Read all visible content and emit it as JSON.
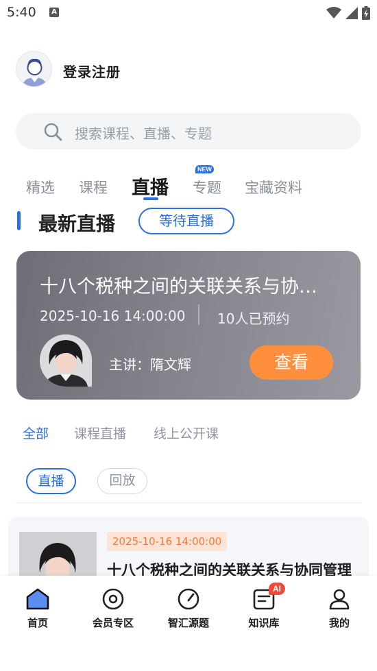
{
  "status_bar": {
    "time": "5:40",
    "notification_letter": "A"
  },
  "profile": {
    "login_label": "登录注册",
    "avatar_icon": "user-avatar-icon"
  },
  "search": {
    "placeholder": "搜索课程、直播、专题",
    "icon": "search-icon"
  },
  "main_tabs": [
    {
      "label": "精选",
      "active": false
    },
    {
      "label": "课程",
      "active": false
    },
    {
      "label": "直播",
      "active": true
    },
    {
      "label": "专题",
      "active": false,
      "badge": "NEW"
    },
    {
      "label": "宝藏资料",
      "active": false
    }
  ],
  "section": {
    "title": "最新直播",
    "waiting_button": "等待直播"
  },
  "live_card": {
    "title": "十八个税种之间的关联关系与协同管理",
    "date": "2025-10-16 14:00:00",
    "booked": "10人已预约",
    "lecturer": "主讲：隋文辉",
    "view_button": "查看"
  },
  "category_tabs": [
    {
      "label": "全部",
      "active": true
    },
    {
      "label": "课程直播",
      "active": false
    },
    {
      "label": "线上公开课",
      "active": false
    }
  ],
  "filters": [
    {
      "label": "直播",
      "active": true
    },
    {
      "label": "回放",
      "active": false
    }
  ],
  "list_items": [
    {
      "date": "2025-10-16 14:00:00",
      "title": "十八个税种之间的关联关系与协同管理"
    }
  ],
  "bottom_nav": [
    {
      "label": "首页",
      "icon": "home-icon",
      "active": true
    },
    {
      "label": "会员专区",
      "icon": "vip-circle-icon",
      "active": false
    },
    {
      "label": "智汇源题",
      "icon": "gauge-icon",
      "active": false
    },
    {
      "label": "知识库",
      "icon": "note-icon",
      "active": false,
      "badge": "AI"
    },
    {
      "label": "我的",
      "icon": "person-icon",
      "active": false
    }
  ],
  "colors": {
    "accent": "#2a6fe0",
    "orange": "#ff8f3d",
    "card_bg": "#7d7b84",
    "ai_badge": "#f04a3a"
  }
}
